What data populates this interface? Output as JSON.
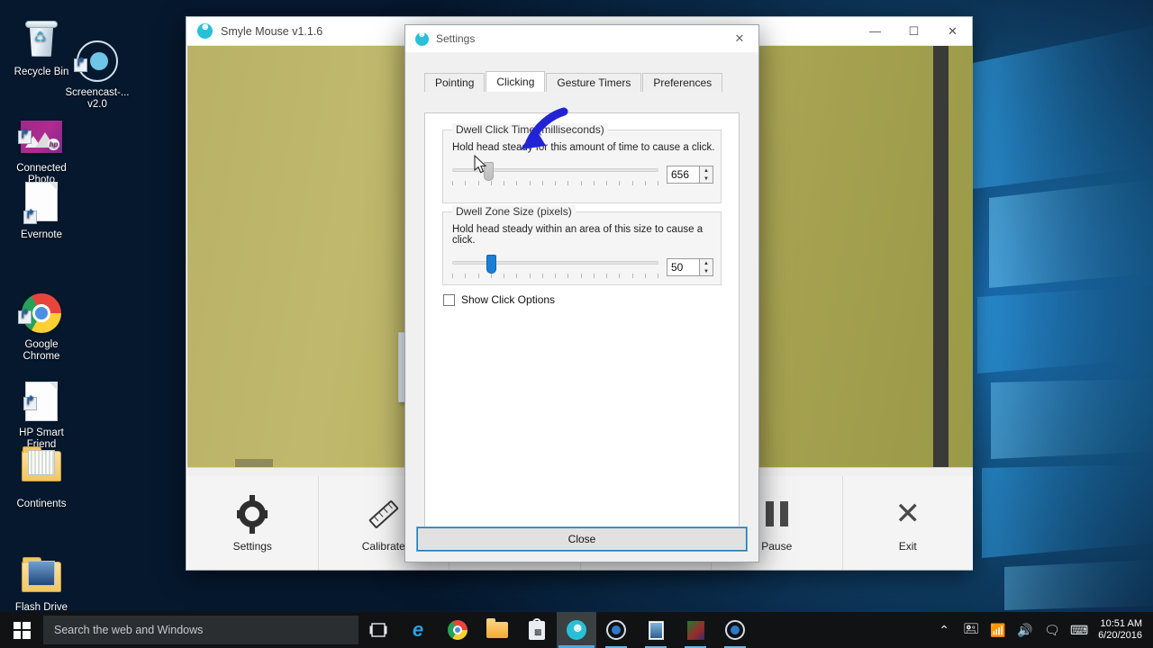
{
  "desktop": {
    "icons": [
      {
        "label": "Recycle Bin",
        "icon": "recycle-bin-icon",
        "shortcut": false
      },
      {
        "label": "Screencast-...\nv2.0",
        "icon": "screencast-ring-icon",
        "shortcut": true
      },
      {
        "label": "Connected\nPhoto",
        "icon": "connected-photo-icon",
        "shortcut": true
      },
      {
        "label": "Evernote",
        "icon": "document-icon",
        "shortcut": true
      },
      {
        "label": "Google\nChrome",
        "icon": "chrome-icon",
        "shortcut": true
      },
      {
        "label": "HP Smart\nFriend",
        "icon": "document-icon",
        "shortcut": true
      },
      {
        "label": "Continents",
        "icon": "folder-icon",
        "shortcut": false
      },
      {
        "label": "Flash Drive\nBackup",
        "icon": "folder-icon",
        "shortcut": false
      }
    ]
  },
  "taskbar": {
    "start_icon": "windows-logo-icon",
    "search_placeholder": "Search the web and Windows",
    "buttons": [
      {
        "name": "task-view-icon",
        "glyph": "❐"
      },
      {
        "name": "edge-icon",
        "glyph": "e"
      },
      {
        "name": "chrome-icon",
        "glyph": ""
      },
      {
        "name": "file-explorer-icon",
        "glyph": ""
      },
      {
        "name": "store-icon",
        "glyph": ""
      },
      {
        "name": "smyle-mouse-icon",
        "glyph": "☻"
      },
      {
        "name": "screencast-icon",
        "glyph": ""
      },
      {
        "name": "photos-icon",
        "glyph": ""
      },
      {
        "name": "xbox-icon",
        "glyph": ""
      },
      {
        "name": "screencast-2-icon",
        "glyph": ""
      }
    ],
    "tray": [
      {
        "name": "show-hidden-icons-chevron",
        "glyph": "⌃"
      },
      {
        "name": "removable-media-icon",
        "glyph": "🖭"
      },
      {
        "name": "wifi-icon",
        "glyph": "📶"
      },
      {
        "name": "volume-icon",
        "glyph": "🔊"
      },
      {
        "name": "action-center-icon",
        "glyph": "🗨"
      },
      {
        "name": "touch-keyboard-icon",
        "glyph": "⌨"
      }
    ],
    "clock_time": "10:51 AM",
    "clock_date": "6/20/2016"
  },
  "smyle_window": {
    "title": "Smyle Mouse v1.1.6",
    "minimize_label": "—",
    "maximize_label": "☐",
    "close_label": "✕",
    "toolbar": [
      {
        "label": "Settings",
        "icon": "gear-icon"
      },
      {
        "label": "Calibrate",
        "icon": "ruler-icon"
      },
      {
        "label": "",
        "icon": "hidden-button-icon"
      },
      {
        "label": "",
        "icon": "hidden-button-2-icon"
      },
      {
        "label": "Pause",
        "icon": "pause-icon"
      },
      {
        "label": "Exit",
        "icon": "x-icon"
      }
    ]
  },
  "settings_dialog": {
    "title": "Settings",
    "close_x": "✕",
    "tabs": [
      {
        "label": "Pointing",
        "active": false
      },
      {
        "label": "Clicking",
        "active": true
      },
      {
        "label": "Gesture Timers",
        "active": false
      },
      {
        "label": "Preferences",
        "active": false
      }
    ],
    "dwell_click_time": {
      "group_title": "Dwell Click Time (milliseconds)",
      "description": "Hold head steady for this amount of time to cause a click.",
      "value": "656",
      "thumb_percent": 16,
      "tick_count": 17,
      "spin_up": "▲",
      "spin_down": "▼"
    },
    "dwell_zone_size": {
      "group_title": "Dwell Zone Size (pixels)",
      "description": "Hold head steady within an area of this size to cause a click.",
      "value": "50",
      "thumb_percent": 17,
      "tick_count": 17,
      "spin_up": "▲",
      "spin_down": "▼"
    },
    "show_click_options": {
      "label": "Show Click Options",
      "checked": false
    },
    "close_button": "Close"
  },
  "annotation": {
    "type": "curved-arrow",
    "color": "#2323d6"
  }
}
